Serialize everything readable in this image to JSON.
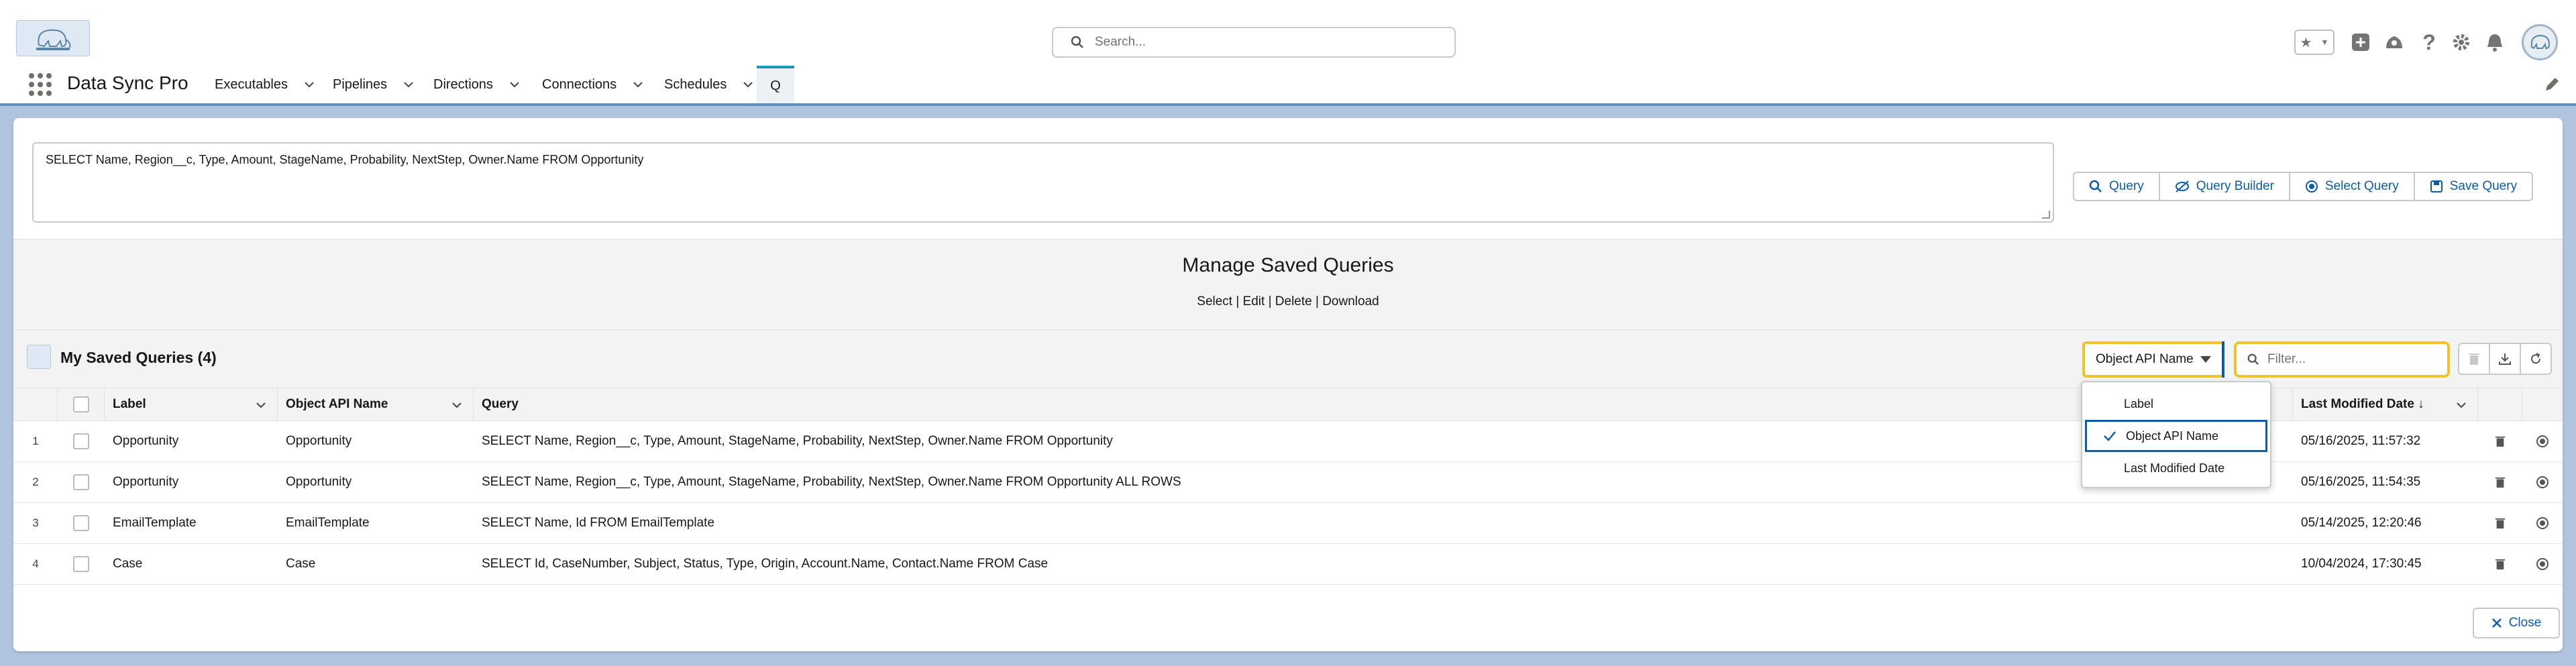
{
  "header": {
    "search_placeholder": "Search...",
    "icons": [
      "favorites-star-icon",
      "favorites-menu-icon",
      "add-icon",
      "trailhead-icon",
      "help-icon",
      "setup-gear-icon",
      "notifications-bell-icon",
      "avatar"
    ]
  },
  "nav": {
    "app_name": "Data Sync Pro",
    "items": [
      {
        "label": "Executables"
      },
      {
        "label": "Pipelines"
      },
      {
        "label": "Directions"
      },
      {
        "label": "Connections"
      },
      {
        "label": "Schedules"
      }
    ],
    "active_tab": "Q"
  },
  "query_editor": {
    "value": "SELECT Name, Region__c, Type, Amount, StageName, Probability, NextStep, Owner.Name FROM Opportunity"
  },
  "buttons": {
    "query": "Query",
    "query_builder": "Query Builder",
    "select_query": "Select Query",
    "save_query": "Save Query"
  },
  "manage": {
    "title": "Manage Saved Queries",
    "actions": "Select | Edit | Delete | Download"
  },
  "list": {
    "title": "My Saved Queries (4)",
    "filter_field": "Object API Name",
    "filter_placeholder": "Filter...",
    "columns": {
      "label": "Label",
      "object": "Object API Name",
      "query": "Query",
      "date": "Last Modified Date ↓"
    },
    "rows": [
      {
        "num": "1",
        "label": "Opportunity",
        "object": "Opportunity",
        "query": "SELECT Name, Region__c, Type, Amount, StageName, Probability, NextStep, Owner.Name FROM Opportunity",
        "date": "05/16/2025, 11:57:32"
      },
      {
        "num": "2",
        "label": "Opportunity",
        "object": "Opportunity",
        "query": "SELECT Name, Region__c, Type, Amount, StageName, Probability, NextStep, Owner.Name FROM Opportunity ALL ROWS",
        "date": "05/16/2025, 11:54:35"
      },
      {
        "num": "3",
        "label": "EmailTemplate",
        "object": "EmailTemplate",
        "query": "SELECT Name, Id FROM EmailTemplate",
        "date": "05/14/2025, 12:20:46"
      },
      {
        "num": "4",
        "label": "Case",
        "object": "Case",
        "query": "SELECT Id, CaseNumber, Subject, Status, Type, Origin, Account.Name, Contact.Name FROM Case",
        "date": "10/04/2024, 17:30:45"
      }
    ]
  },
  "dropdown": {
    "options": [
      "Label",
      "Object API Name",
      "Last Modified Date"
    ],
    "selected": "Object API Name"
  },
  "close_label": "Close"
}
